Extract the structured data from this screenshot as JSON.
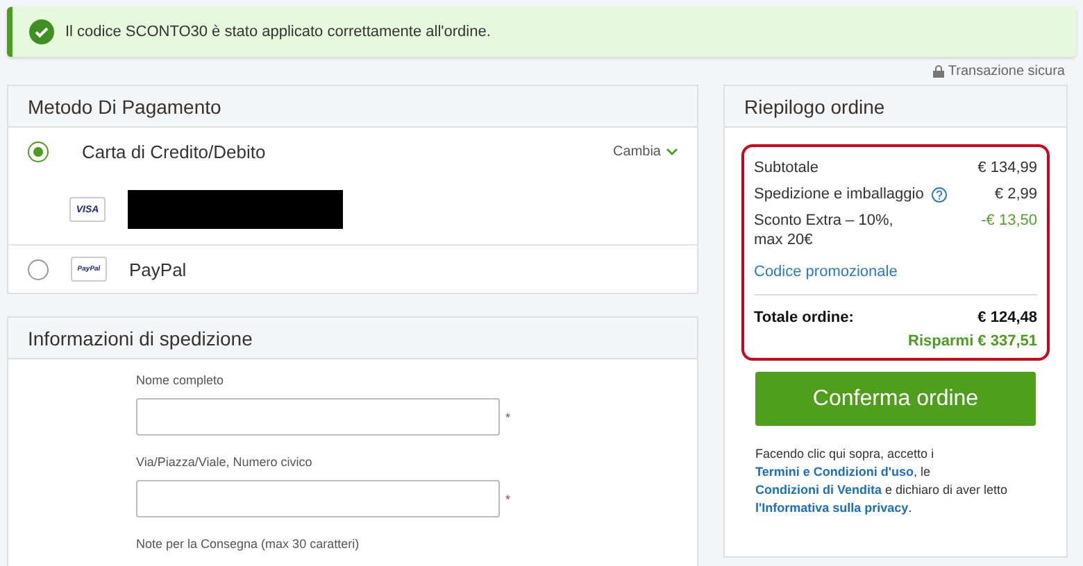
{
  "alert": {
    "kind": "success",
    "message": "Il codice SCONTO30 è stato applicato correttamente all'ordine."
  },
  "secure_note": "Transazione sicura",
  "payment": {
    "title": "Metodo Di Pagamento",
    "methods": [
      {
        "kind": "card",
        "label": "Carta di Credito/Debito",
        "selected": true,
        "change_label": "Cambia",
        "badge": "VISA"
      },
      {
        "kind": "wallet",
        "label": "PayPal",
        "selected": false,
        "badge": "PayPal"
      }
    ]
  },
  "shipping": {
    "title": "Informazioni di spedizione",
    "fields": [
      {
        "kind": "input",
        "label": "Nome completo",
        "required_mark": "*"
      },
      {
        "kind": "input",
        "label": "Via/Piazza/Viale, Numero civico",
        "required_mark": "*"
      },
      {
        "kind": "caption",
        "label": "Note per la Consegna (max 30 caratteri)"
      }
    ]
  },
  "summary": {
    "title": "Riepilogo ordine",
    "lines": [
      {
        "kind": "plain",
        "label": "Subtotale",
        "value": "€ 134,99",
        "help": false
      },
      {
        "kind": "plain",
        "label": "Spedizione e imballaggio",
        "value": "€ 2,99",
        "help": true
      },
      {
        "kind": "discount",
        "label": "Sconto Extra – 10%, max 20€",
        "value": "-€ 13,50",
        "help": false
      }
    ],
    "promo_link": "Codice promozionale",
    "total_label": "Totale ordine:",
    "total_value": "€ 124,48",
    "savings": "Risparmi € 337,51",
    "confirm_button": "Conferma ordine",
    "terms": [
      {
        "kind": "text",
        "text": "Facendo clic qui sopra, accetto i "
      },
      {
        "kind": "link",
        "text": "Termini e Condizioni d'uso"
      },
      {
        "kind": "text",
        "text": ", le "
      },
      {
        "kind": "link",
        "text": "Condizioni di Vendita"
      },
      {
        "kind": "text",
        "text": " e dichiaro di aver letto "
      },
      {
        "kind": "link",
        "text": "l'Informativa sulla privacy"
      },
      {
        "kind": "text",
        "text": "."
      }
    ]
  }
}
